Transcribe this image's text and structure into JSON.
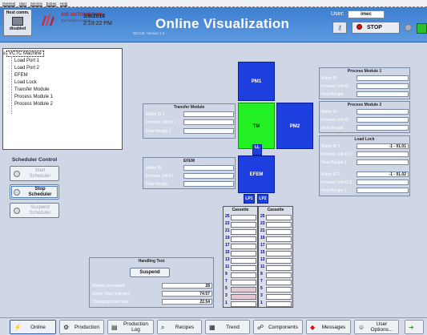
{
  "menubar": {
    "items": [
      "General",
      "User",
      "Service",
      "Extras",
      "Help"
    ]
  },
  "header": {
    "host_comm_label": "Host comm.",
    "host_status": "disabled",
    "company_name": "AIS AUTOMATION",
    "company_sub": "SOFTWARE SYSTEMS",
    "date": "1/8/2016",
    "time": "2:19:22 PM",
    "title": "Online Visualization",
    "version": "WCCM, Version 1.5",
    "user_label": "User:",
    "user_value": "imec",
    "stop_label": "STOP"
  },
  "colors": {
    "accent": "#3d7fd1",
    "module": "#1e3fe0",
    "active_module": "#22f022",
    "stop": "#d11111",
    "status_ok": "#2cc22c"
  },
  "icons": {
    "host": "computer-icon",
    "logo": "ais-logo-icon",
    "login": "key-icon",
    "stop": "red-dot-icon",
    "status": "green-status-icon"
  },
  "tree": {
    "root": "VCTC Machine",
    "children": [
      "Load Port 1",
      "Load Port 2",
      "EFEM",
      "Load Lock",
      "Transfer Module",
      "Process Module 1",
      "Process Module 2"
    ]
  },
  "scheduler": {
    "title": "Scheduler Control",
    "start": [
      "Start",
      "Scheduler"
    ],
    "stop": [
      "Stop",
      "Scheduler"
    ],
    "suspend": [
      "Suspend",
      "Scheduler"
    ]
  },
  "modules": {
    "pm1": "PM1",
    "pm2": "PM2",
    "tm": "TM",
    "efem": "EFEM",
    "ll": "LL",
    "lp1": "LP1",
    "lp2": "LP2"
  },
  "transfer_module": {
    "title": "Transfer Module",
    "fields": [
      {
        "label": "Wafer ID 1",
        "value": ""
      },
      {
        "label": "Process Job ID 1",
        "value": ""
      },
      {
        "label": "Flow Recipe 1",
        "value": ""
      }
    ]
  },
  "efem_panel": {
    "title": "EFEM",
    "fields": [
      {
        "label": "Wafer ID",
        "value": ""
      },
      {
        "label": "Process Job ID",
        "value": ""
      },
      {
        "label": "Flow Recipe",
        "value": ""
      }
    ]
  },
  "process_module_1": {
    "title": "Process Module 1",
    "fields": [
      {
        "label": "Wafer ID",
        "value": ""
      },
      {
        "label": "Process Job ID",
        "value": ""
      },
      {
        "label": "Flow Recipe",
        "value": ""
      }
    ]
  },
  "process_module_2": {
    "title": "Process Module 2",
    "fields": [
      {
        "label": "Wafer ID",
        "value": ""
      },
      {
        "label": "Process Job ID",
        "value": ""
      },
      {
        "label": "Flow Recipe",
        "value": ""
      }
    ]
  },
  "load_lock": {
    "title": "Load Lock",
    "fields": [
      {
        "label": "Wafer ID 1",
        "value": "-1 - 01.01"
      },
      {
        "label": "Process Job ID 1",
        "value": ""
      },
      {
        "label": "Flow Recipe 1",
        "value": ""
      },
      {
        "label": "Wafer ID 2",
        "value": "-1 - 01.02"
      },
      {
        "label": "Process Job ID 2",
        "value": ""
      },
      {
        "label": "Flow Recipe 2",
        "value": ""
      }
    ]
  },
  "cassettes": [
    {
      "title": "Cassette",
      "slots": [
        "25",
        "23",
        "21",
        "19",
        "17",
        "15",
        "13",
        "11",
        "9",
        "7",
        "5",
        "3",
        "1"
      ],
      "occupied": [
        "5",
        "3"
      ]
    },
    {
      "title": "Cassette",
      "slots": [
        "25",
        "23",
        "21",
        "19",
        "17",
        "15",
        "13",
        "11",
        "9",
        "7",
        "5",
        "3",
        "1"
      ],
      "occupied": []
    }
  ],
  "handling_test": {
    "title": "Handling Test",
    "button": "Suspend",
    "fields": [
      {
        "label": "Wafers processed",
        "value": "28"
      },
      {
        "label": "Active Time [min:sec]",
        "value": "74:57"
      },
      {
        "label": "Throughput per hour",
        "value": "22.54"
      }
    ]
  },
  "taskbar": {
    "items": [
      {
        "label": "Online",
        "icon": "online-icon"
      },
      {
        "label": "Production",
        "icon": "production-icon"
      },
      {
        "label": "Production Log",
        "icon": "log-icon"
      },
      {
        "label": "Recipes",
        "icon": "recipes-icon"
      },
      {
        "label": "Trend",
        "icon": "trend-icon"
      },
      {
        "label": "Components",
        "icon": "components-icon"
      },
      {
        "label": "Messages",
        "icon": "messages-icon"
      },
      {
        "label": "User Options...",
        "icon": "user-options-icon"
      }
    ]
  }
}
